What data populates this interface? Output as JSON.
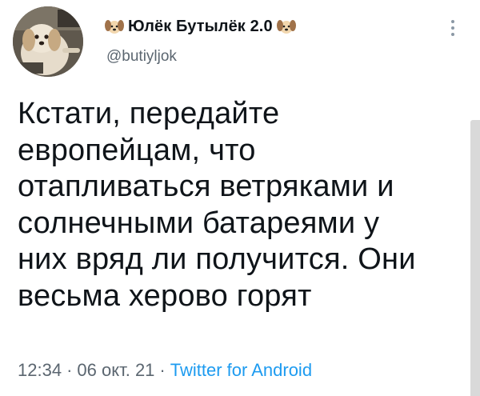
{
  "author": {
    "display_name": "Юлёк Бутылёк 2.0",
    "handle": "@butiyljok",
    "name_emoji_icon": "dog-face-icon"
  },
  "tweet": {
    "text": "Кстати, передайте\nевропейцам, что\nотапливаться ветряками и\nсолнечными батареями у\nних вряд ли получится. Они\nвесьма херово горят",
    "time": "12:34",
    "date": "06 окт. 21",
    "source": "Twitter for Android",
    "separator": "·"
  },
  "colors": {
    "text": "#0f1419",
    "secondary": "#5b6670",
    "link": "#1d9bf0"
  }
}
